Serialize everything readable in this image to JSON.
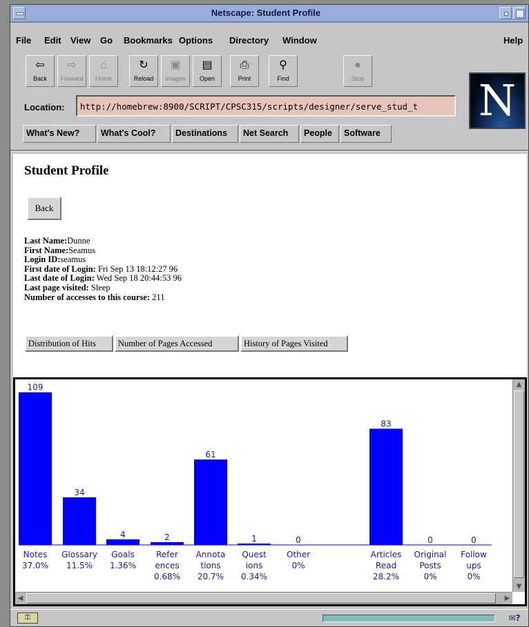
{
  "window": {
    "title": "Netscape: Student Profile"
  },
  "menubar": [
    "File",
    "Edit",
    "View",
    "Go",
    "Bookmarks",
    "Options",
    "Directory",
    "Window",
    "Help"
  ],
  "toolbar": [
    {
      "label": "Back",
      "icon": "back-arrow-icon",
      "enabled": true
    },
    {
      "label": "Forward",
      "icon": "forward-arrow-icon",
      "enabled": false
    },
    {
      "label": "Home",
      "icon": "home-icon",
      "enabled": false
    },
    {
      "label": "Reload",
      "icon": "reload-icon",
      "enabled": true
    },
    {
      "label": "Images",
      "icon": "images-icon",
      "enabled": false
    },
    {
      "label": "Open",
      "icon": "open-icon",
      "enabled": true
    },
    {
      "label": "Print",
      "icon": "print-icon",
      "enabled": true
    },
    {
      "label": "Find",
      "icon": "find-icon",
      "enabled": true
    },
    {
      "label": "Stop",
      "icon": "stop-icon",
      "enabled": false
    }
  ],
  "location": {
    "label": "Location:",
    "value": "http://homebrew:8900/SCRIPT/CPSC315/scripts/designer/serve_stud_t"
  },
  "directory_buttons": [
    "What's New?",
    "What's Cool?",
    "Destinations",
    "Net Search",
    "People",
    "Software"
  ],
  "page": {
    "title": "Student Profile",
    "back_button": "Back",
    "fields": [
      {
        "label": "Last Name:",
        "value": "Dunne"
      },
      {
        "label": "First Name:",
        "value": "Seamus"
      },
      {
        "label": "Login ID:",
        "value": "seamus"
      },
      {
        "label": "First date of Login:",
        "value": " Fri Sep 13 18:12:27 96"
      },
      {
        "label": "Last date of Login:",
        "value": " Wed Sep 18 20:44:53 96"
      },
      {
        "label": "Last page visited:",
        "value": " Sleep"
      },
      {
        "label": "Number of accesses to this course:",
        "value": " 211"
      }
    ],
    "view_buttons": [
      "Distribution of Hits",
      "Number of Pages Accessed",
      "History of Pages Visited"
    ]
  },
  "chart_data": {
    "type": "bar",
    "bar_color": "#0000ff",
    "label_color": "#1a1aa6",
    "categories": [
      {
        "label": [
          "Notes"
        ],
        "value": 109,
        "percent": "37.0%"
      },
      {
        "label": [
          "Glossary"
        ],
        "value": 34,
        "percent": "11.5%"
      },
      {
        "label": [
          "Goals"
        ],
        "value": 4,
        "percent": "1.36%"
      },
      {
        "label": [
          "Refer",
          "ences"
        ],
        "value": 2,
        "percent": "0.68%"
      },
      {
        "label": [
          "Annota",
          "tions"
        ],
        "value": 61,
        "percent": "20.7%"
      },
      {
        "label": [
          "Quest",
          "ions"
        ],
        "value": 1,
        "percent": "0.34%"
      },
      {
        "label": [
          "Other"
        ],
        "value": 0,
        "percent": "0%"
      },
      {
        "label": [
          "Articles",
          "Read"
        ],
        "value": 83,
        "percent": "28.2%"
      },
      {
        "label": [
          "Original",
          "Posts"
        ],
        "value": 0,
        "percent": "0%"
      },
      {
        "label": [
          "Follow",
          "ups"
        ],
        "value": 0,
        "percent": "0%"
      }
    ]
  },
  "status": {
    "security_icon": "security-key-icon",
    "mail_icon": "mail-icon"
  }
}
